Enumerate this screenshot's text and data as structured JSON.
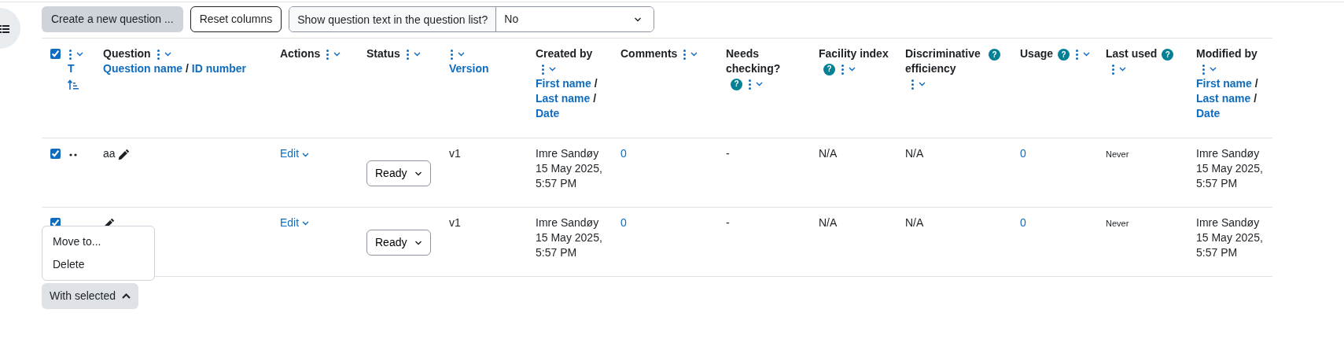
{
  "toolbar": {
    "create_button": "Create a new question ...",
    "reset_button": "Reset columns",
    "show_text": {
      "label": "Show question text in the question list?",
      "value": "No"
    }
  },
  "header_checkbox": {
    "checked": true
  },
  "columns": [
    {
      "kind": "sort",
      "sort_link": "T"
    },
    {
      "kind": "column",
      "title": "Question",
      "links": [
        "Question name",
        "ID number"
      ],
      "separator": "/"
    },
    {
      "kind": "column",
      "title": "Actions"
    },
    {
      "kind": "column",
      "title": "Status"
    },
    {
      "kind": "column",
      "links": [
        "Version"
      ]
    },
    {
      "kind": "column",
      "title": "Created by",
      "links": [
        "First name",
        "Last name",
        "Date"
      ],
      "separator": "/"
    },
    {
      "kind": "column",
      "title": "Comments"
    },
    {
      "kind": "column",
      "title": "Needs checking?",
      "help": "?"
    },
    {
      "kind": "column",
      "title": "Facility index",
      "help": "?"
    },
    {
      "kind": "column",
      "title": "Discriminative efficiency",
      "help": "?"
    },
    {
      "kind": "column",
      "title": "Usage",
      "help": "?"
    },
    {
      "kind": "column",
      "title": "Last used",
      "help": "?"
    },
    {
      "kind": "column",
      "title": "Modified by",
      "links": [
        "First name",
        "Last name",
        "Date"
      ],
      "separator": "/"
    }
  ],
  "rows": [
    {
      "selected": true,
      "drag_handle": true,
      "name": "aa",
      "action": "Edit",
      "status": "Ready",
      "version": "v1",
      "created_by": "Imre Sandøy",
      "created_date": "15 May 2025, 5:57 PM",
      "comments": "0",
      "needs_checking": "-",
      "facility_index": "N/A",
      "discriminative_efficiency": "N/A",
      "usage": "0",
      "last_used": "Never",
      "modified_by": "Imre Sandøy",
      "modified_date": "15 May 2025, 5:57 PM"
    },
    {
      "selected": true,
      "drag_handle": false,
      "action": "Edit",
      "status": "Ready",
      "version": "v1",
      "created_by": "Imre Sandøy",
      "created_date": "15 May 2025, 5:57 PM",
      "comments": "0",
      "needs_checking": "-",
      "facility_index": "N/A",
      "discriminative_efficiency": "N/A",
      "usage": "0",
      "last_used": "Never",
      "modified_by": "Imre Sandøy",
      "modified_date": "15 May 2025, 5:57 PM"
    }
  ],
  "bulk": {
    "with_selected": "With selected",
    "menu_open": true,
    "menu_items": [
      "Move to...",
      "Delete"
    ]
  }
}
